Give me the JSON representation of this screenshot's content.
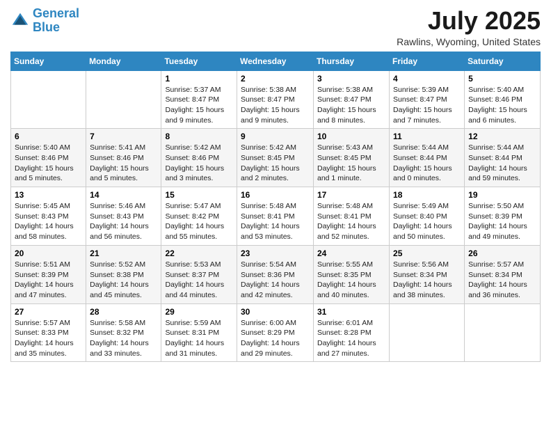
{
  "logo": {
    "text1": "General",
    "text2": "Blue"
  },
  "title": "July 2025",
  "location": "Rawlins, Wyoming, United States",
  "days_of_week": [
    "Sunday",
    "Monday",
    "Tuesday",
    "Wednesday",
    "Thursday",
    "Friday",
    "Saturday"
  ],
  "weeks": [
    [
      {
        "day": "",
        "info": ""
      },
      {
        "day": "",
        "info": ""
      },
      {
        "day": "1",
        "sunrise": "Sunrise: 5:37 AM",
        "sunset": "Sunset: 8:47 PM",
        "daylight": "Daylight: 15 hours and 9 minutes."
      },
      {
        "day": "2",
        "sunrise": "Sunrise: 5:38 AM",
        "sunset": "Sunset: 8:47 PM",
        "daylight": "Daylight: 15 hours and 9 minutes."
      },
      {
        "day": "3",
        "sunrise": "Sunrise: 5:38 AM",
        "sunset": "Sunset: 8:47 PM",
        "daylight": "Daylight: 15 hours and 8 minutes."
      },
      {
        "day": "4",
        "sunrise": "Sunrise: 5:39 AM",
        "sunset": "Sunset: 8:47 PM",
        "daylight": "Daylight: 15 hours and 7 minutes."
      },
      {
        "day": "5",
        "sunrise": "Sunrise: 5:40 AM",
        "sunset": "Sunset: 8:46 PM",
        "daylight": "Daylight: 15 hours and 6 minutes."
      }
    ],
    [
      {
        "day": "6",
        "sunrise": "Sunrise: 5:40 AM",
        "sunset": "Sunset: 8:46 PM",
        "daylight": "Daylight: 15 hours and 5 minutes."
      },
      {
        "day": "7",
        "sunrise": "Sunrise: 5:41 AM",
        "sunset": "Sunset: 8:46 PM",
        "daylight": "Daylight: 15 hours and 5 minutes."
      },
      {
        "day": "8",
        "sunrise": "Sunrise: 5:42 AM",
        "sunset": "Sunset: 8:46 PM",
        "daylight": "Daylight: 15 hours and 3 minutes."
      },
      {
        "day": "9",
        "sunrise": "Sunrise: 5:42 AM",
        "sunset": "Sunset: 8:45 PM",
        "daylight": "Daylight: 15 hours and 2 minutes."
      },
      {
        "day": "10",
        "sunrise": "Sunrise: 5:43 AM",
        "sunset": "Sunset: 8:45 PM",
        "daylight": "Daylight: 15 hours and 1 minute."
      },
      {
        "day": "11",
        "sunrise": "Sunrise: 5:44 AM",
        "sunset": "Sunset: 8:44 PM",
        "daylight": "Daylight: 15 hours and 0 minutes."
      },
      {
        "day": "12",
        "sunrise": "Sunrise: 5:44 AM",
        "sunset": "Sunset: 8:44 PM",
        "daylight": "Daylight: 14 hours and 59 minutes."
      }
    ],
    [
      {
        "day": "13",
        "sunrise": "Sunrise: 5:45 AM",
        "sunset": "Sunset: 8:43 PM",
        "daylight": "Daylight: 14 hours and 58 minutes."
      },
      {
        "day": "14",
        "sunrise": "Sunrise: 5:46 AM",
        "sunset": "Sunset: 8:43 PM",
        "daylight": "Daylight: 14 hours and 56 minutes."
      },
      {
        "day": "15",
        "sunrise": "Sunrise: 5:47 AM",
        "sunset": "Sunset: 8:42 PM",
        "daylight": "Daylight: 14 hours and 55 minutes."
      },
      {
        "day": "16",
        "sunrise": "Sunrise: 5:48 AM",
        "sunset": "Sunset: 8:41 PM",
        "daylight": "Daylight: 14 hours and 53 minutes."
      },
      {
        "day": "17",
        "sunrise": "Sunrise: 5:48 AM",
        "sunset": "Sunset: 8:41 PM",
        "daylight": "Daylight: 14 hours and 52 minutes."
      },
      {
        "day": "18",
        "sunrise": "Sunrise: 5:49 AM",
        "sunset": "Sunset: 8:40 PM",
        "daylight": "Daylight: 14 hours and 50 minutes."
      },
      {
        "day": "19",
        "sunrise": "Sunrise: 5:50 AM",
        "sunset": "Sunset: 8:39 PM",
        "daylight": "Daylight: 14 hours and 49 minutes."
      }
    ],
    [
      {
        "day": "20",
        "sunrise": "Sunrise: 5:51 AM",
        "sunset": "Sunset: 8:39 PM",
        "daylight": "Daylight: 14 hours and 47 minutes."
      },
      {
        "day": "21",
        "sunrise": "Sunrise: 5:52 AM",
        "sunset": "Sunset: 8:38 PM",
        "daylight": "Daylight: 14 hours and 45 minutes."
      },
      {
        "day": "22",
        "sunrise": "Sunrise: 5:53 AM",
        "sunset": "Sunset: 8:37 PM",
        "daylight": "Daylight: 14 hours and 44 minutes."
      },
      {
        "day": "23",
        "sunrise": "Sunrise: 5:54 AM",
        "sunset": "Sunset: 8:36 PM",
        "daylight": "Daylight: 14 hours and 42 minutes."
      },
      {
        "day": "24",
        "sunrise": "Sunrise: 5:55 AM",
        "sunset": "Sunset: 8:35 PM",
        "daylight": "Daylight: 14 hours and 40 minutes."
      },
      {
        "day": "25",
        "sunrise": "Sunrise: 5:56 AM",
        "sunset": "Sunset: 8:34 PM",
        "daylight": "Daylight: 14 hours and 38 minutes."
      },
      {
        "day": "26",
        "sunrise": "Sunrise: 5:57 AM",
        "sunset": "Sunset: 8:34 PM",
        "daylight": "Daylight: 14 hours and 36 minutes."
      }
    ],
    [
      {
        "day": "27",
        "sunrise": "Sunrise: 5:57 AM",
        "sunset": "Sunset: 8:33 PM",
        "daylight": "Daylight: 14 hours and 35 minutes."
      },
      {
        "day": "28",
        "sunrise": "Sunrise: 5:58 AM",
        "sunset": "Sunset: 8:32 PM",
        "daylight": "Daylight: 14 hours and 33 minutes."
      },
      {
        "day": "29",
        "sunrise": "Sunrise: 5:59 AM",
        "sunset": "Sunset: 8:31 PM",
        "daylight": "Daylight: 14 hours and 31 minutes."
      },
      {
        "day": "30",
        "sunrise": "Sunrise: 6:00 AM",
        "sunset": "Sunset: 8:29 PM",
        "daylight": "Daylight: 14 hours and 29 minutes."
      },
      {
        "day": "31",
        "sunrise": "Sunrise: 6:01 AM",
        "sunset": "Sunset: 8:28 PM",
        "daylight": "Daylight: 14 hours and 27 minutes."
      },
      {
        "day": "",
        "info": ""
      },
      {
        "day": "",
        "info": ""
      }
    ]
  ]
}
